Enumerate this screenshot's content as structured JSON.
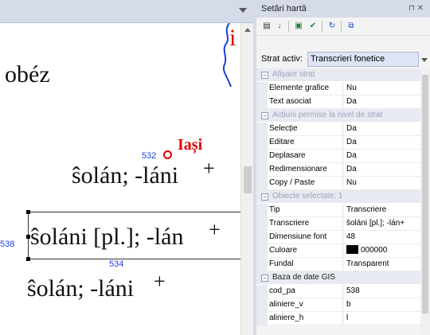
{
  "map": {
    "word_top": "obéz",
    "point_label_1": "532",
    "city": "Iași",
    "line1": "ŝolán; -láni",
    "point_label_2": "538",
    "line2": "ŝoláni [pl.]; -lán",
    "point_label_3": "534",
    "line3": "ŝolán; -láni",
    "plus": "+",
    "fragment": "i",
    "colors": {
      "city": "#e00000",
      "point": "#1a3fd6",
      "river": "#1a3fd6"
    }
  },
  "panel": {
    "title": "Setări hartă",
    "pin": "ᵽ ✕",
    "layer_label": "Strat activ:",
    "layer_value": "Transcrieri fonetice",
    "categories": [
      {
        "name": "Afișare strat",
        "rows": [
          {
            "k": "Elemente grafice",
            "v": "Nu"
          },
          {
            "k": "Text asociat",
            "v": "Da"
          }
        ]
      },
      {
        "name": "Acțiuni permise la nivel de strat",
        "rows": [
          {
            "k": "Selecție",
            "v": "Da"
          },
          {
            "k": "Editare",
            "v": "Da"
          },
          {
            "k": "Deplasare",
            "v": "Da"
          },
          {
            "k": "Redimensionare",
            "v": "Da"
          },
          {
            "k": "Copy / Paste",
            "v": "Nu"
          }
        ]
      },
      {
        "name": "Obiecte selectate: 1",
        "rows": [
          {
            "k": "Tip",
            "v": "Transcriere"
          },
          {
            "k": "Transcriere",
            "v": "ŝoláni [pl.]; -lán+"
          },
          {
            "k": "Dimensiune font",
            "v": "48"
          },
          {
            "k": "Culoare",
            "v": "000000"
          },
          {
            "k": "Fundal",
            "v": "Transparent"
          }
        ]
      },
      {
        "name": "Baza de date GIS",
        "rows": [
          {
            "k": "cod_pa",
            "v": "538"
          },
          {
            "k": "aliniere_v",
            "v": "b"
          },
          {
            "k": "aliniere_h",
            "v": "l"
          }
        ]
      }
    ]
  }
}
